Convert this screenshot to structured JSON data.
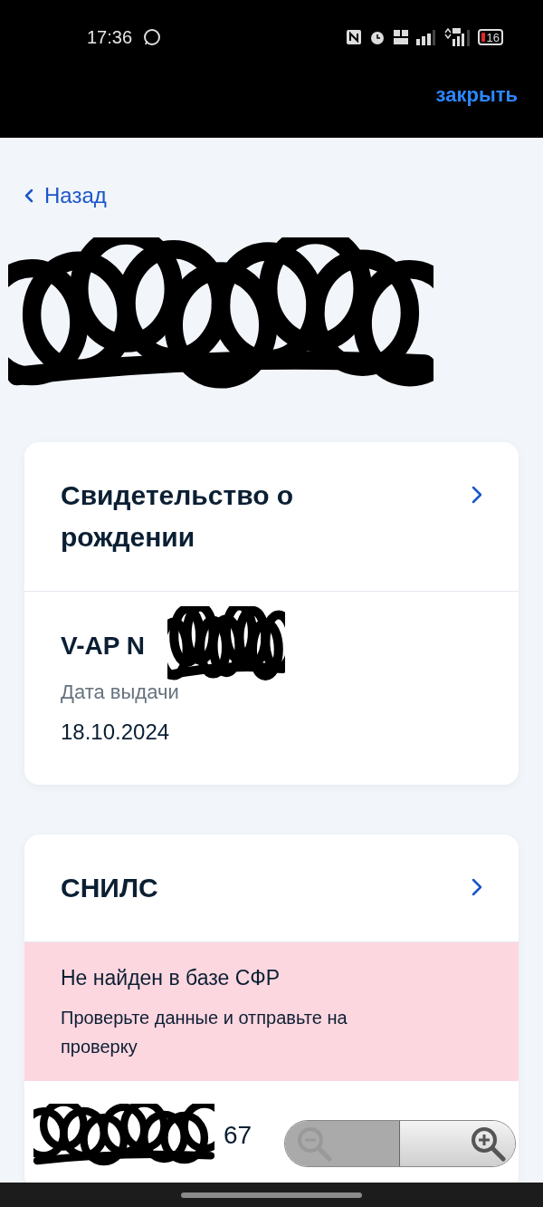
{
  "status_bar": {
    "time": "17:36",
    "battery": "16"
  },
  "header": {
    "close": "закрыть"
  },
  "back": "Назад",
  "documents": [
    {
      "title": "Свидетельство о рождении",
      "number": "V-AP N",
      "fields": [
        {
          "label": "Дата выдачи",
          "value": "18.10.2024"
        }
      ]
    },
    {
      "title": "СНИЛС",
      "alert": {
        "title": "Не найден в базе СФР",
        "text": "Проверьте данные и отправьте на проверку"
      },
      "number": "67"
    }
  ],
  "zoom_control": {
    "zoom_out": {
      "disabled": true
    },
    "zoom_in": {
      "disabled": false
    }
  }
}
